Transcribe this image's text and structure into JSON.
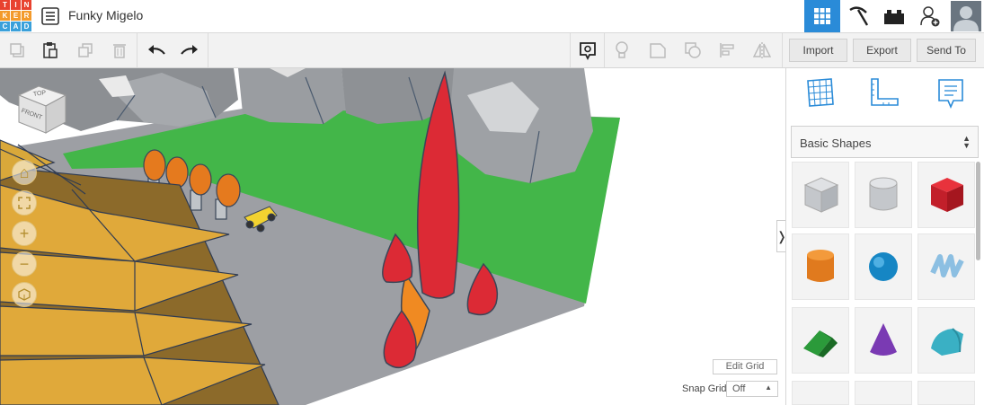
{
  "app": {
    "logo_letters": [
      "T",
      "I",
      "N",
      "K",
      "E",
      "R",
      "C",
      "A",
      "D"
    ],
    "logo_colors": [
      "#e8422f",
      "#e8422f",
      "#e8422f",
      "#f39a2b",
      "#f39a2b",
      "#f39a2b",
      "#3aa0da",
      "#3aa0da",
      "#3aa0da"
    ],
    "title": "Funky Migelo"
  },
  "topbar": {
    "icons": [
      "grid-view-icon",
      "pickaxe-icon",
      "bricks-icon",
      "add-user-icon",
      "profile-avatar"
    ],
    "active_color": "#2a8bd8"
  },
  "toolbar": {
    "left_icons": [
      "copy-icon",
      "paste-icon",
      "duplicate-icon",
      "delete-icon",
      "undo-icon",
      "redo-icon"
    ],
    "right_icons": [
      "note-icon",
      "light-bulb-icon",
      "group-icon",
      "ungroup-icon",
      "align-icon",
      "mirror-icon"
    ],
    "import_label": "Import",
    "export_label": "Export",
    "send_to_label": "Send To"
  },
  "viewcube": {
    "top_label": "TOP",
    "front_label": "FRONT"
  },
  "viewport_controls": {
    "edit_grid_label": "Edit Grid",
    "snap_grid_label": "Snap Grid",
    "snap_grid_value": "Off"
  },
  "panel": {
    "tab_icons": [
      "workplane-icon",
      "ruler-icon",
      "notes-icon"
    ],
    "shape_category": "Basic Shapes",
    "shapes": [
      "Box Hole",
      "Cylinder Hole",
      "Box",
      "Cylinder",
      "Sphere",
      "Scribble",
      "Roof",
      "Cone",
      "Round Roof"
    ]
  }
}
